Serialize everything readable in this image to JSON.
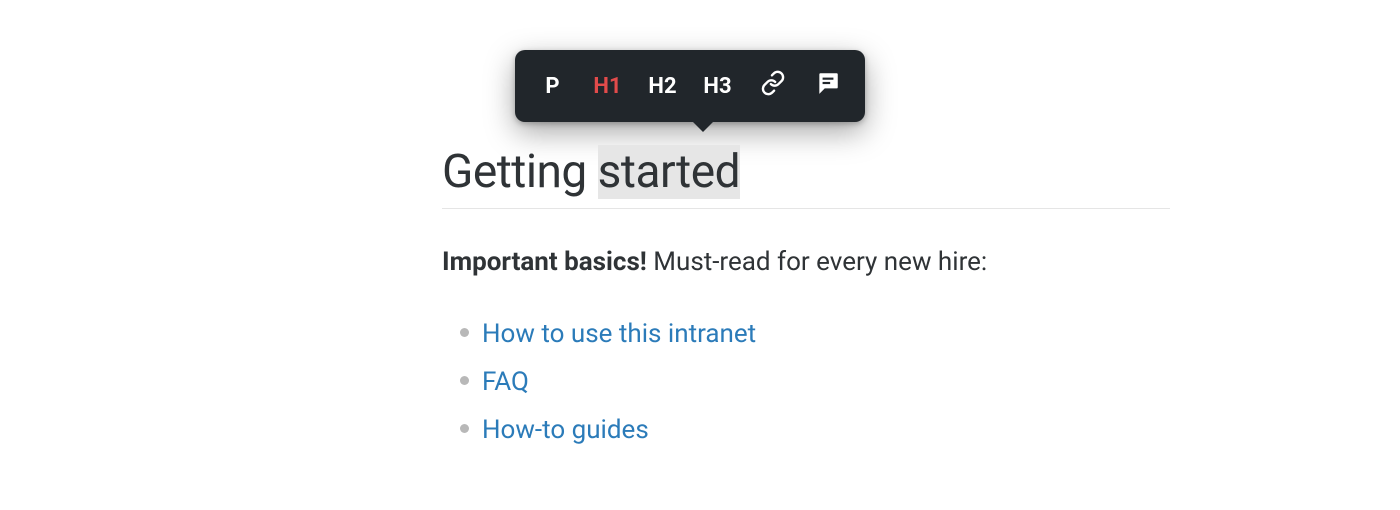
{
  "toolbar": {
    "p_label": "P",
    "h1_label": "H1",
    "h2_label": "H2",
    "h3_label": "H3",
    "active": "h1"
  },
  "heading": {
    "prefix": "Getting ",
    "selected": "started"
  },
  "intro": {
    "bold": "Important basics!",
    "rest": " Must-read for every new hire:"
  },
  "links": [
    {
      "label": "How to use this intranet"
    },
    {
      "label": "FAQ"
    },
    {
      "label": "How-to guides"
    }
  ],
  "colors": {
    "toolbar_bg": "#21262b",
    "active": "#e24b4b",
    "link": "#2b7bb9",
    "text": "#2f3336",
    "bullet": "#b8b8b8",
    "highlight": "#e6e6e6"
  }
}
